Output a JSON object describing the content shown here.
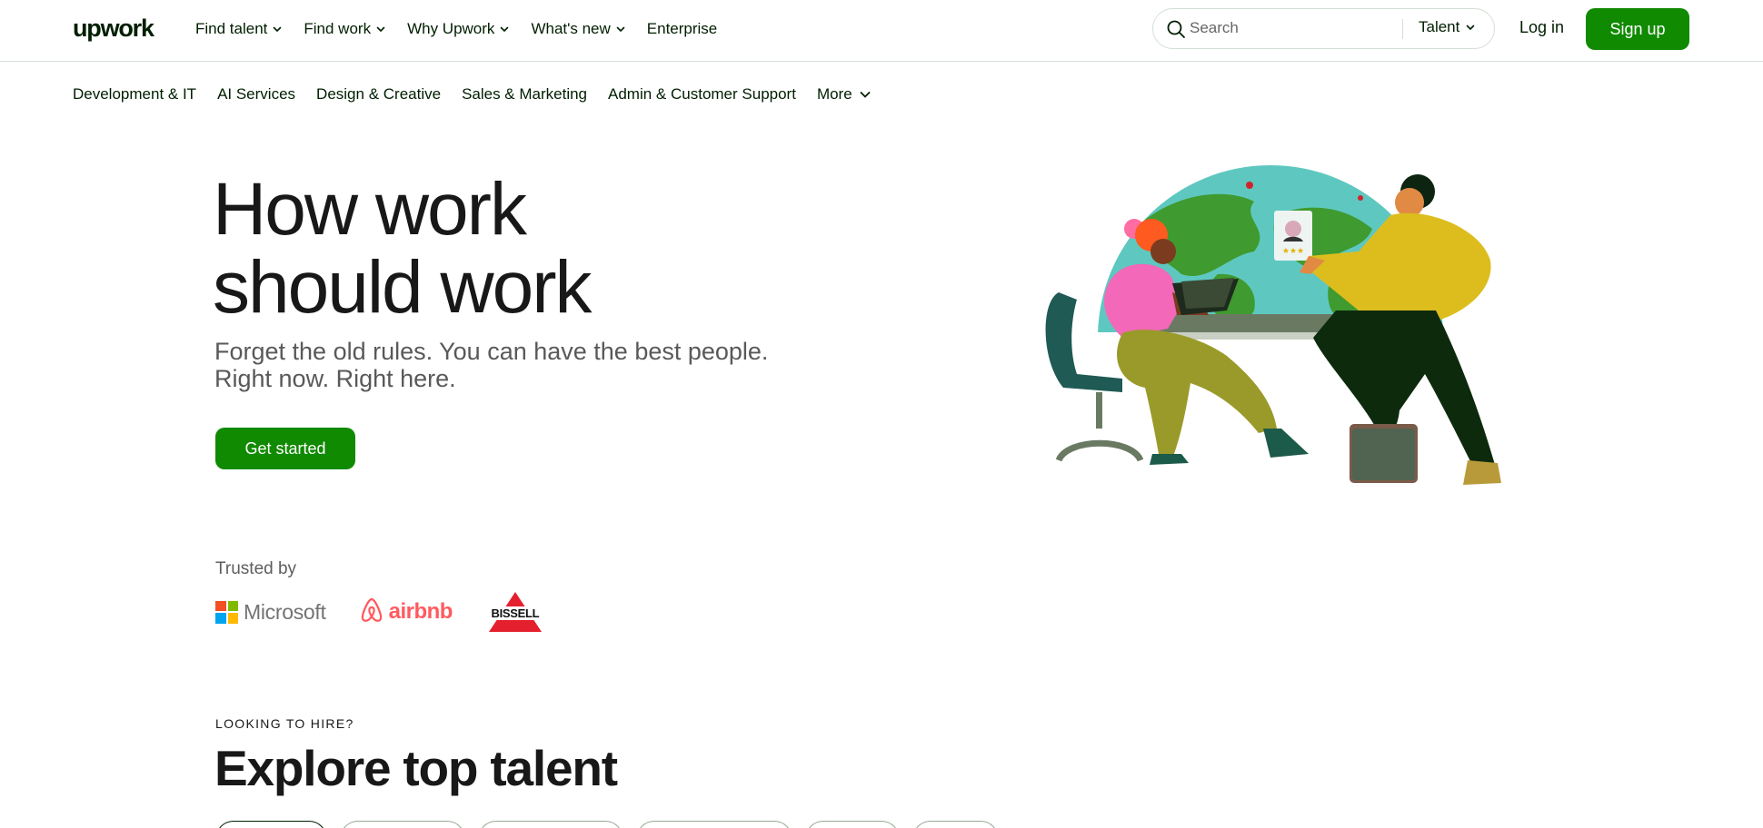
{
  "brand": {
    "logo_text": "upwork",
    "accent_color": "#108a00"
  },
  "topnav": {
    "links": [
      {
        "label": "Find talent",
        "has_dropdown": true
      },
      {
        "label": "Find work",
        "has_dropdown": true
      },
      {
        "label": "Why Upwork",
        "has_dropdown": true
      },
      {
        "label": "What's new",
        "has_dropdown": true
      },
      {
        "label": "Enterprise",
        "has_dropdown": false
      }
    ],
    "search": {
      "placeholder": "Search",
      "value": "",
      "scope": "Talent",
      "icon": "search-icon"
    },
    "login_label": "Log in",
    "signup_label": "Sign up"
  },
  "categories": [
    {
      "label": "Development & IT"
    },
    {
      "label": "AI Services"
    },
    {
      "label": "Design & Creative"
    },
    {
      "label": "Sales & Marketing"
    },
    {
      "label": "Admin & Customer Support"
    },
    {
      "label": "More",
      "has_dropdown": true
    }
  ],
  "hero": {
    "title_line1": "How work",
    "title_line2": "should work",
    "subtitle_line1": "Forget the old rules. You can have the best people.",
    "subtitle_line2": "Right now. Right here.",
    "cta_label": "Get started"
  },
  "trusted": {
    "label": "Trusted by",
    "logos": [
      {
        "name": "Microsoft",
        "text": "Microsoft"
      },
      {
        "name": "airbnb",
        "text": "airbnb"
      },
      {
        "name": "Bissell",
        "text": "BISSELL"
      }
    ]
  },
  "explore": {
    "eyebrow": "Looking to hire?",
    "title": "Explore top talent",
    "pill_count_visible": 6
  }
}
